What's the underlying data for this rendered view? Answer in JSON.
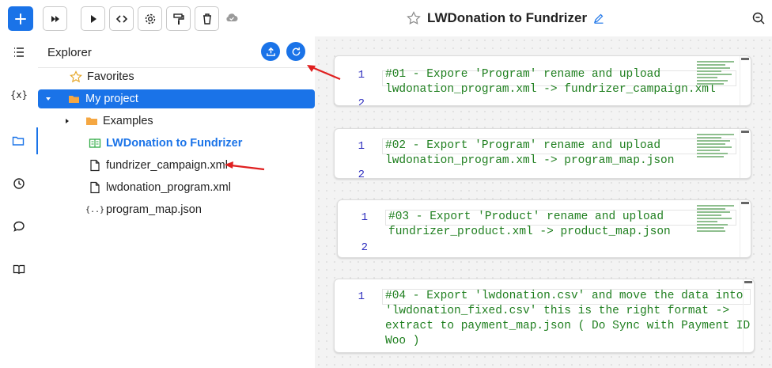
{
  "toolbar": {
    "buttons": [
      "add-icon",
      "fast-forward-icon",
      "play-icon",
      "code-icon",
      "gear-icon",
      "paint-roller-icon",
      "trash-icon"
    ],
    "cloud_icon": "cloud-check-icon"
  },
  "document": {
    "title": "LWDonation to Fundrizer",
    "star_icon": "star-outline-icon",
    "edit_icon": "pencil-icon"
  },
  "activity_bar": [
    "list-icon",
    "variables-icon",
    "folder-icon",
    "history-icon",
    "chat-icon",
    "book-icon"
  ],
  "explorer": {
    "title": "Explorer",
    "items": [
      {
        "label": "Favorites",
        "icon": "star-outline-icon"
      },
      {
        "label": "My project",
        "icon": "folder-open-icon"
      },
      {
        "label": "Examples",
        "icon": "folder-icon"
      },
      {
        "label": "LWDonation to Fundrizer",
        "icon": "notebook-icon"
      },
      {
        "label": "fundrizer_campaign.xml",
        "icon": "file-icon"
      },
      {
        "label": "lwdonation_program.xml",
        "icon": "file-icon"
      },
      {
        "label": "program_map.json",
        "icon": "json-file-icon"
      }
    ]
  },
  "cells": [
    {
      "lines": [
        "1",
        "2"
      ],
      "text": "#01 - Expore 'Program' rename and upload\nlwdonation_program.xml -> fundrizer_campaign.xml"
    },
    {
      "lines": [
        "1",
        "2"
      ],
      "text": "#02 - Export 'Program' rename and upload\nlwdonation_program.xml -> program_map.json"
    },
    {
      "lines": [
        "1",
        "2"
      ],
      "text": "#03 - Export 'Product' rename and upload\nfundrizer_product.xml -> product_map.json"
    },
    {
      "lines": [
        "1"
      ],
      "text": "#04 - Export 'lwdonation.csv' and move the data into\n'lwdonation_fixed.csv' this is the right format ->\nextract to payment_map.json ( Do Sync with Payment ID on\nWoo )"
    }
  ],
  "colors": {
    "accent": "#1a73e8",
    "code_green": "#1f7f1f",
    "annotation_red": "#e02020",
    "folder_orange": "#f5a742"
  }
}
